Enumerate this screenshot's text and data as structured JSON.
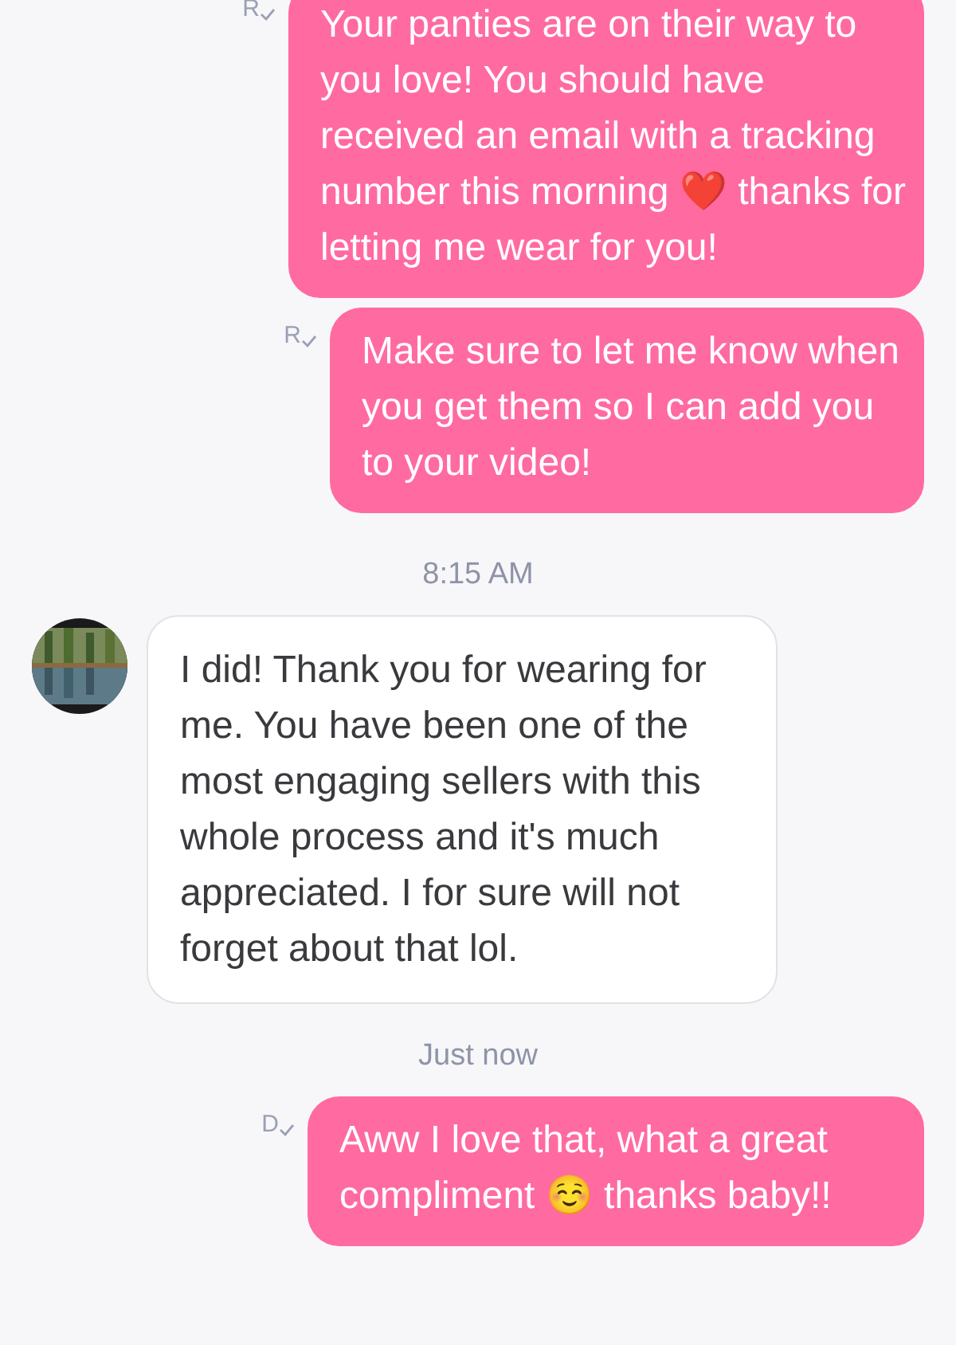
{
  "messages": [
    {
      "kind": "outgoing",
      "receipt": "R",
      "text": "Your panties are on their way to you love! You should have received an email with a tracking number this morning ❤️ thanks for letting me wear for you!"
    },
    {
      "kind": "outgoing",
      "receipt": "R",
      "text": "Make sure to let me know when you get them so I can add you to your video!"
    },
    {
      "kind": "time",
      "text": "8:15 AM"
    },
    {
      "kind": "incoming",
      "text": "I did! Thank you for wearing for me. You have been one of the most engaging sellers with this whole process and it's much appreciated. I for sure will not forget about that lol."
    },
    {
      "kind": "time",
      "text": "Just now"
    },
    {
      "kind": "outgoing",
      "receipt": "D",
      "text": "Aww I love that, what a great compliment ☺️ thanks baby!!"
    }
  ]
}
